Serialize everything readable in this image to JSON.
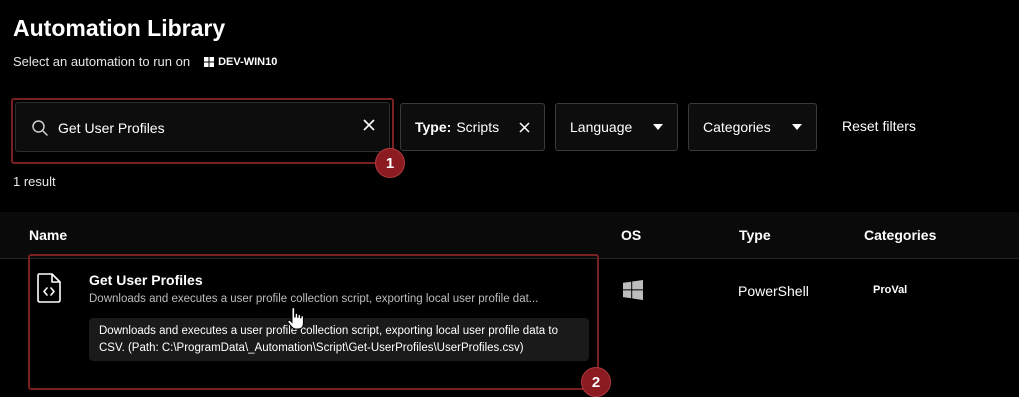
{
  "page": {
    "title": "Automation Library",
    "subtitle": "Select an automation to run on",
    "device": "DEV-WIN10"
  },
  "search": {
    "value": "Get User Profiles",
    "placeholder": ""
  },
  "filters": {
    "type_label": "Type:",
    "type_value": "Scripts",
    "language": "Language",
    "categories": "Categories",
    "reset": "Reset filters"
  },
  "results": {
    "count_text": "1 result"
  },
  "table": {
    "headers": [
      "Name",
      "OS",
      "Type",
      "Categories"
    ],
    "rows": [
      {
        "name": "Get User Profiles",
        "description": "Downloads and executes a user profile collection script, exporting local user profile dat...",
        "tooltip": "Downloads and executes a user profile collection script, exporting local user profile data to CSV. (Path: C:\\ProgramData\\_Automation\\Script\\Get-UserProfiles\\UserProfiles.csv)",
        "os_icon": "windows-icon",
        "type": "PowerShell",
        "category": "ProVal"
      }
    ]
  },
  "annotations": {
    "step1": "1",
    "step2": "2"
  },
  "colors": {
    "background": "#000000",
    "annotation": "#8b1b20",
    "tooltip_bg": "#1a1a1a"
  }
}
